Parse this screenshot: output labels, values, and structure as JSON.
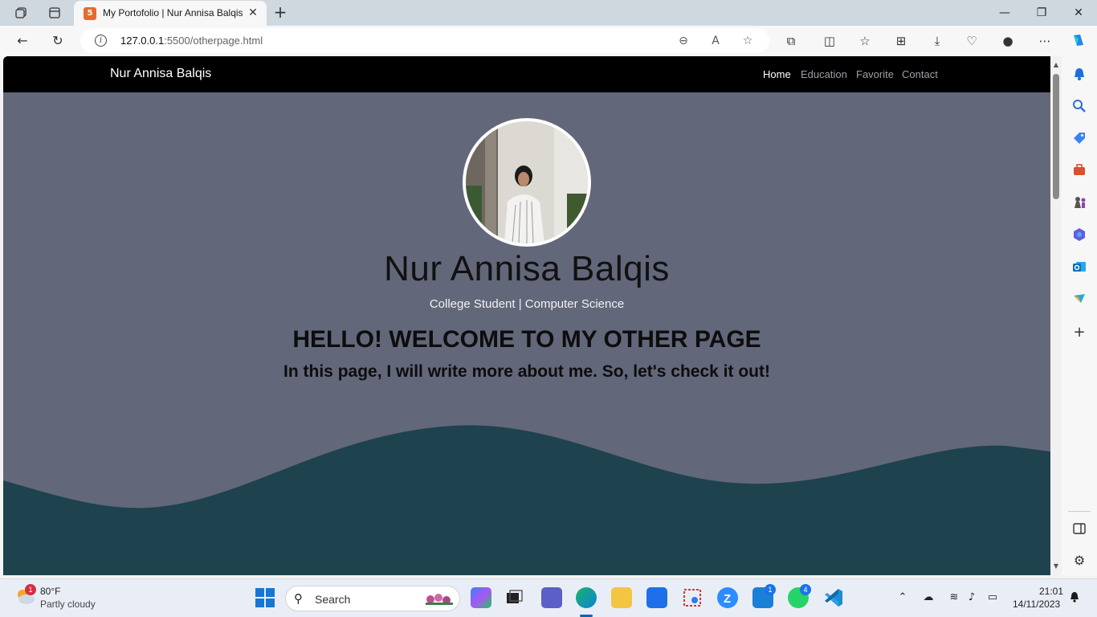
{
  "browser": {
    "tab": {
      "title": "My Portofolio | Nur Annisa Balqis",
      "favicon": "5"
    },
    "address": {
      "host": "127.0.0.1",
      "rest": ":5500/otherpage.html"
    }
  },
  "site": {
    "brand": "Nur Annisa Balqis",
    "nav": [
      "Home",
      "Education",
      "Favorite",
      "Contact"
    ],
    "hero": {
      "name": "Nur Annisa Balqis",
      "subtitle": "College Student | Computer Science",
      "heading": "HELLO! WELCOME TO MY OTHER PAGE",
      "subheading": "In this page, I will write more about me. So, let's check it out!"
    },
    "colors": {
      "page_bg": "#63677a",
      "wave": "#1e424e",
      "nav_bg": "#000000"
    }
  },
  "taskbar": {
    "weather": {
      "temp": "80°F",
      "desc": "Partly cloudy",
      "badge": "1"
    },
    "search_label": "Search",
    "badges": {
      "mail": "1",
      "whatsapp": "4"
    },
    "time": "21:01",
    "date": "14/11/2023"
  }
}
